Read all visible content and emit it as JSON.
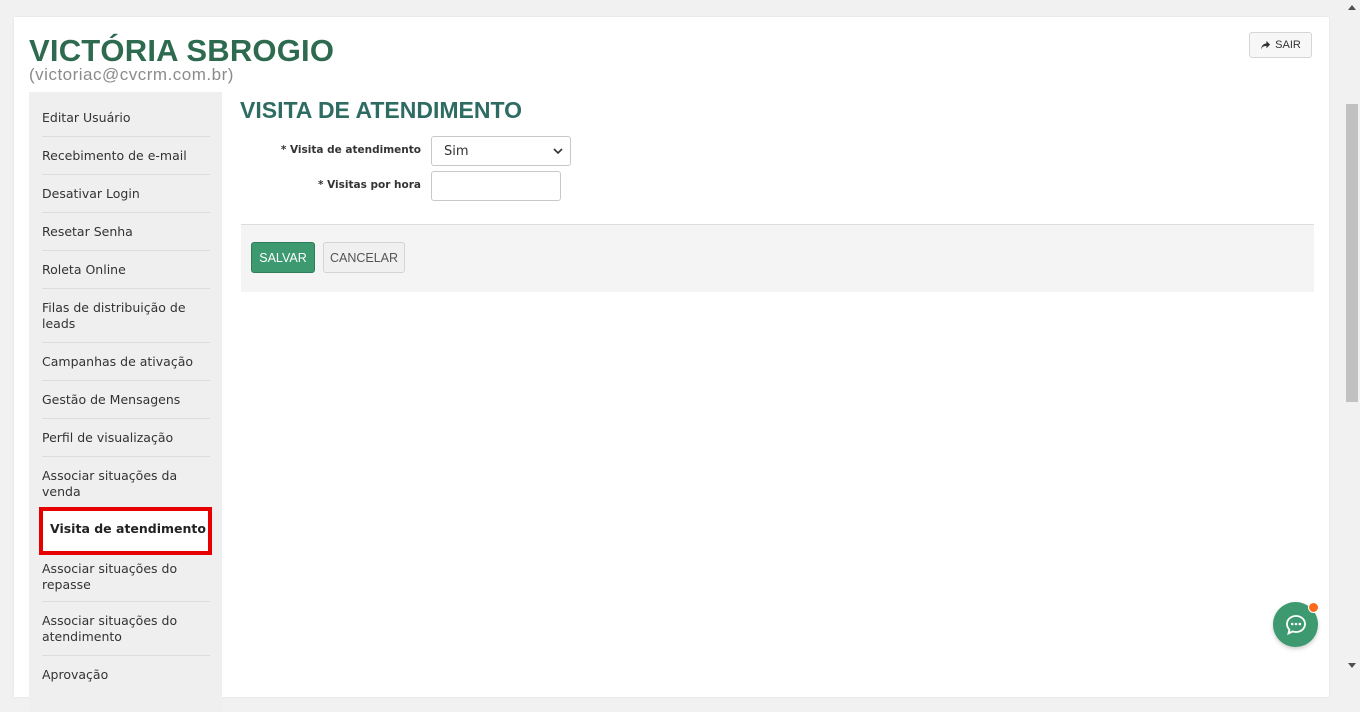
{
  "header": {
    "user_name": "VICTÓRIA SBROGIO",
    "user_email": "(victoriac@cvcrm.com.br)",
    "logout_label": "SAIR",
    "logout_icon": "share-arrow-icon"
  },
  "sidebar": {
    "items": [
      {
        "label": "Editar Usuário"
      },
      {
        "label": "Recebimento de e-mail"
      },
      {
        "label": "Desativar Login"
      },
      {
        "label": "Resetar Senha"
      },
      {
        "label": "Roleta Online"
      },
      {
        "label": "Filas de distribuição de leads"
      },
      {
        "label": "Campanhas de ativação"
      },
      {
        "label": "Gestão de Mensagens"
      },
      {
        "label": "Perfil de visualização"
      },
      {
        "label": "Associar situações da venda"
      },
      {
        "label": "Visita de atendimento"
      },
      {
        "label": "Associar situações do repasse"
      },
      {
        "label": "Associar situações do atendimento"
      },
      {
        "label": "Aprovação"
      }
    ],
    "active_index": 10
  },
  "main": {
    "title": "VISITA DE ATENDIMENTO",
    "form": {
      "visita_label": "* Visita de atendimento",
      "visita_value": "Sim",
      "visitas_hora_label": "* Visitas por hora",
      "visitas_hora_value": ""
    },
    "actions": {
      "save_label": "SALVAR",
      "cancel_label": "CANCELAR"
    }
  },
  "colors": {
    "brand_green": "#2d6a4f",
    "title_teal": "#2e6b62",
    "save_button": "#3d9970",
    "highlight_red": "#e60000",
    "chat_badge": "#ff6a1a"
  },
  "chat": {
    "icon": "chat-bubble-icon"
  }
}
